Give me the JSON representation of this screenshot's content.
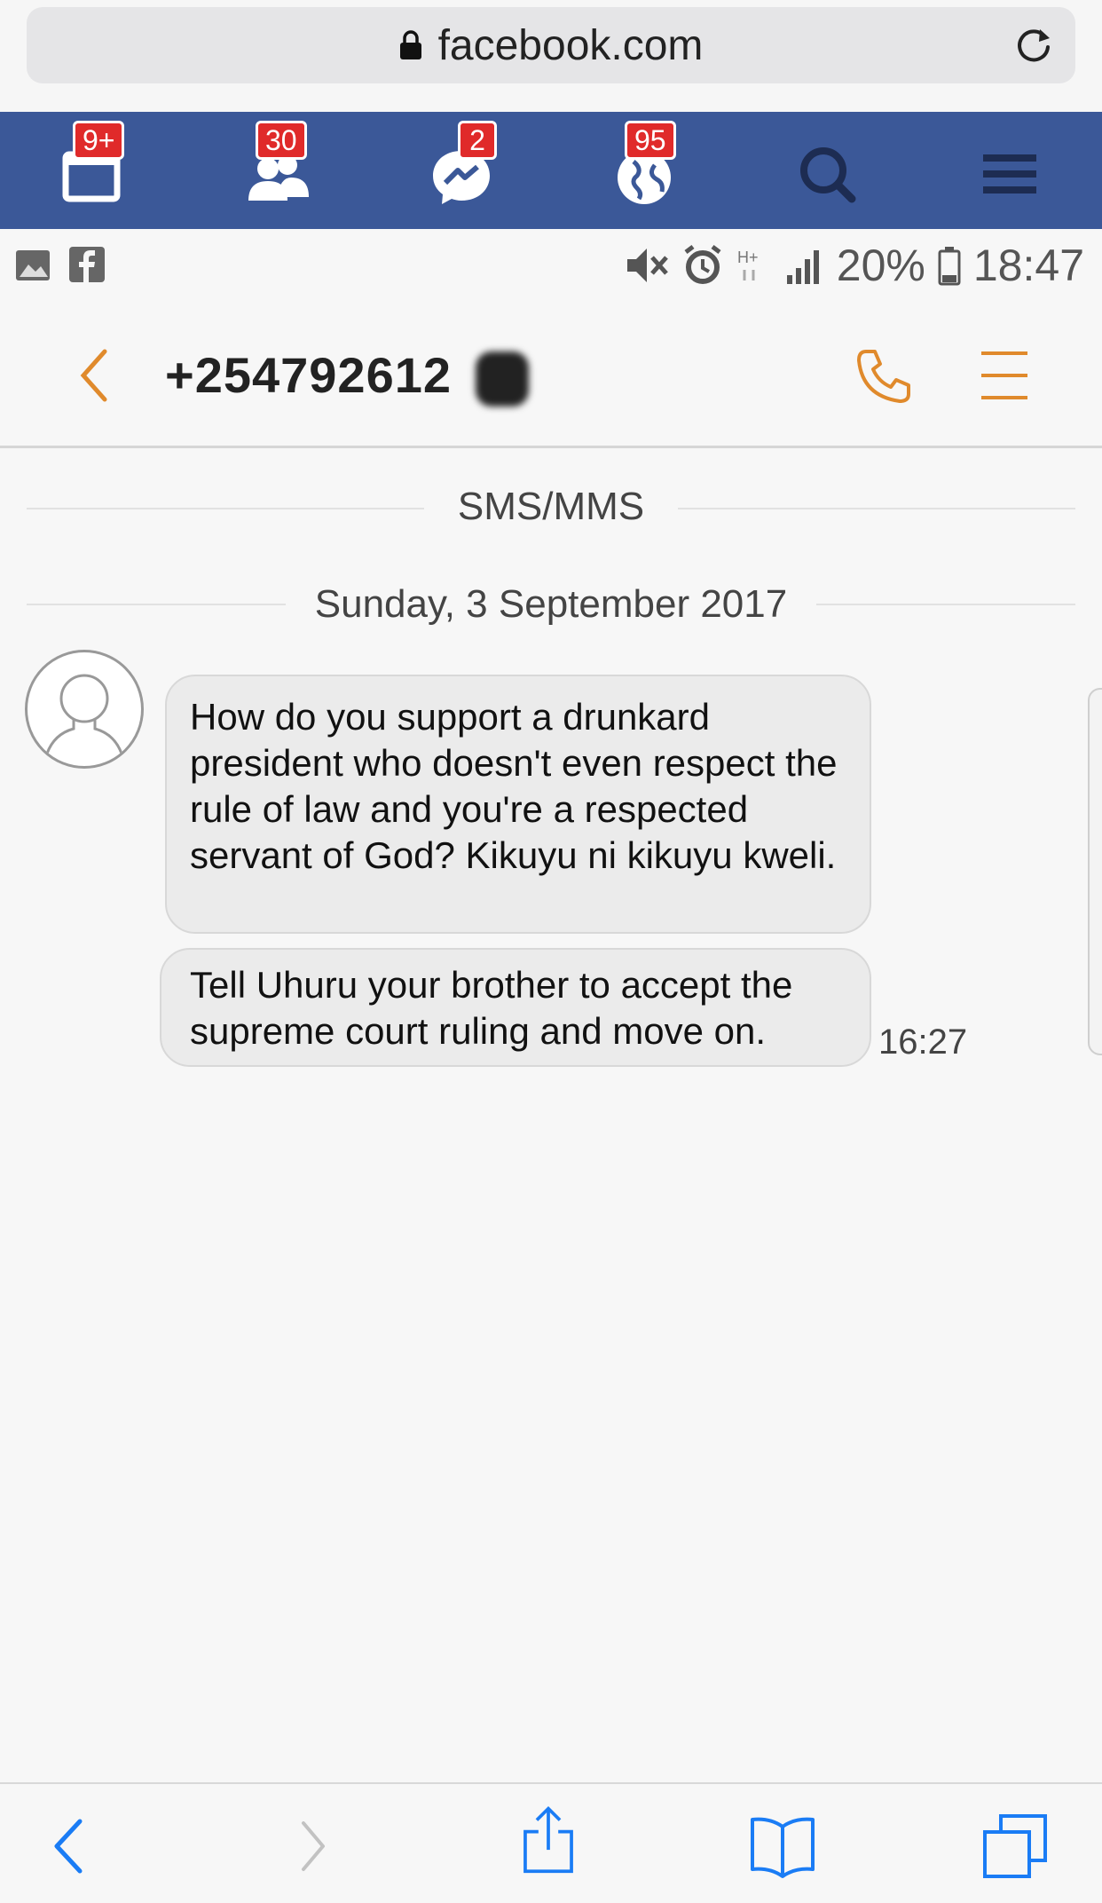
{
  "browser": {
    "url": "facebook.com"
  },
  "facebook_bar": {
    "badges": {
      "friend_requests_tab": "9+",
      "friends": "30",
      "messenger": "2",
      "notifications": "95"
    }
  },
  "status_bar": {
    "battery": "20%",
    "time": "18:47"
  },
  "conversation": {
    "contact": "+254792612",
    "channel_label": "SMS/MMS",
    "date_label": "Sunday, 3 September 2017",
    "messages": [
      {
        "text": "How do you support a drunkard president who doesn't even respect the rule of law and you're a respected servant of God? Kikuyu ni kikuyu kweli."
      },
      {
        "text": "Tell Uhuru your brother to accept the supreme court ruling and move on.",
        "time": "16:27"
      }
    ]
  },
  "colors": {
    "facebook_blue": "#3b5898",
    "badge_red": "#e02a2a",
    "accent_orange": "#e08a2c",
    "safari_blue": "#1a7cf5"
  }
}
